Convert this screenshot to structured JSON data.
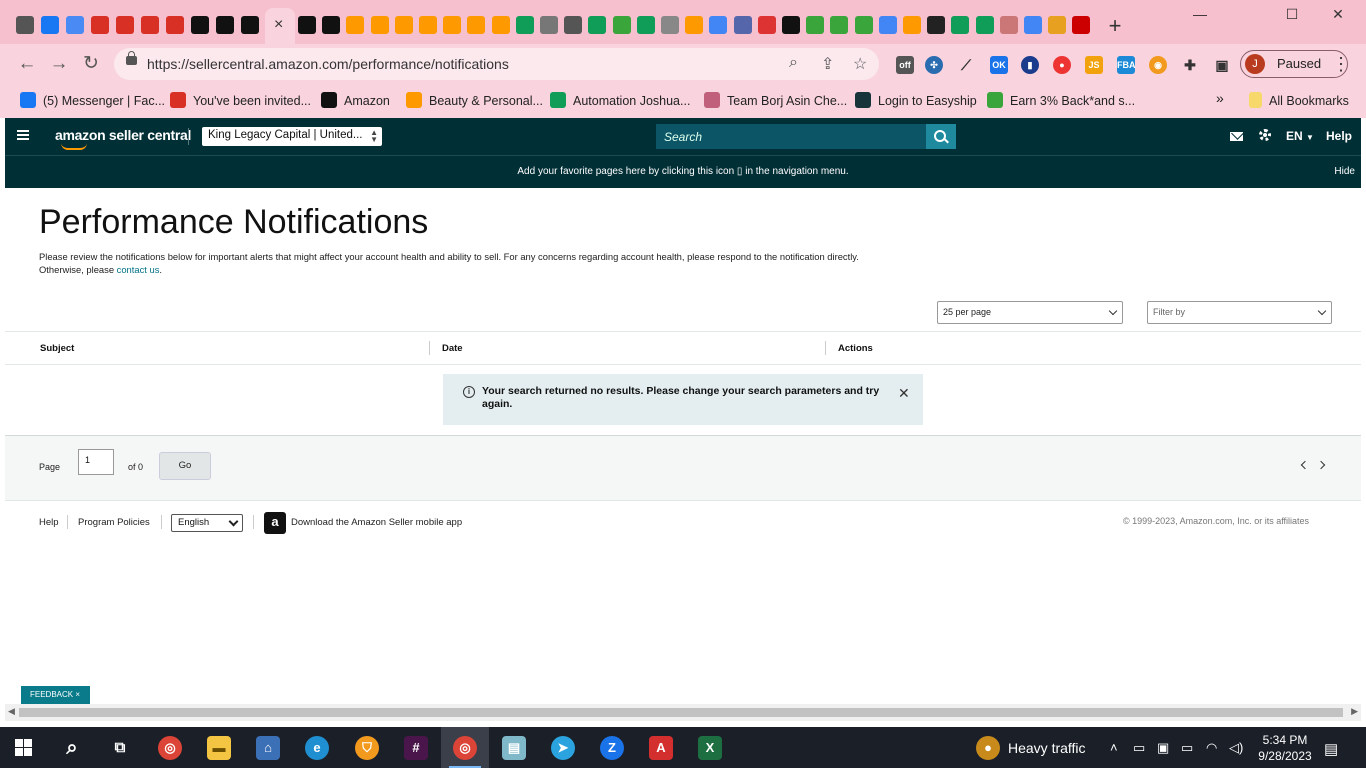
{
  "browser": {
    "active_tab_close": "×",
    "new_tab": "+",
    "window_controls": [
      "—",
      "☐",
      "✕"
    ],
    "url": "https://sellercentral.amazon.com/performance/notifications",
    "profile_initial": "J",
    "profile_status": "Paused",
    "bookmarks": [
      {
        "label": "(5) Messenger | Fac...",
        "icon": "facebook-icon",
        "color": "#1877f2"
      },
      {
        "label": "You've been invited...",
        "icon": "gmail-icon",
        "color": "#d93025"
      },
      {
        "label": "Amazon",
        "icon": "amazon-icon",
        "color": "#111111"
      },
      {
        "label": "Beauty & Personal...",
        "icon": "amazon-smile-icon",
        "color": "#ff9900"
      },
      {
        "label": "Automation Joshua...",
        "icon": "sheets-icon",
        "color": "#0f9d58"
      },
      {
        "label": "Team Borj Asin Che...",
        "icon": "team-icon",
        "color": "#c0607a"
      },
      {
        "label": "Login to Easyship",
        "icon": "easyship-icon",
        "color": "#17343b"
      },
      {
        "label": "Earn 3% Back*and s...",
        "icon": "cashback-icon",
        "color": "#3aa53a"
      }
    ],
    "bookmarks_overflow": "»",
    "all_bookmarks": "All Bookmarks"
  },
  "seller_central": {
    "logo_text": "amazon seller central",
    "account": "King Legacy Capital | United...",
    "search_placeholder": "Search",
    "language": "EN",
    "help": "Help",
    "favorites_banner": "Add your favorite pages here by clicking this icon ▯ in the navigation menu.",
    "hide": "Hide"
  },
  "page": {
    "title": "Performance Notifications",
    "intro_line1": "Please review the notifications below for important alerts that might affect your account health and ability to sell. For any concerns regarding account health, please respond to the notification directly.",
    "intro_line2_prefix": "Otherwise, please ",
    "intro_link": "contact us",
    "intro_line2_suffix": ".",
    "per_page": "25 per page",
    "filter": "Filter by",
    "columns": [
      "Subject",
      "Date",
      "Actions"
    ],
    "alert_text": "Your search returned no results. Please change your search parameters and try again.",
    "alert_close": "✕",
    "pager": {
      "page_label": "Page",
      "page_value": "1",
      "of_label": "of 0",
      "go": "Go"
    }
  },
  "footer": {
    "help": "Help",
    "program_policies": "Program Policies",
    "language": "English",
    "download_app": "Download the Amazon Seller mobile app",
    "copyright": "© 1999-2023, Amazon.com, Inc. or its affiliates",
    "feedback": "FEEDBACK ×"
  },
  "taskbar": {
    "weather": "Heavy traffic",
    "time": "5:34 PM",
    "date": "9/28/2023"
  }
}
